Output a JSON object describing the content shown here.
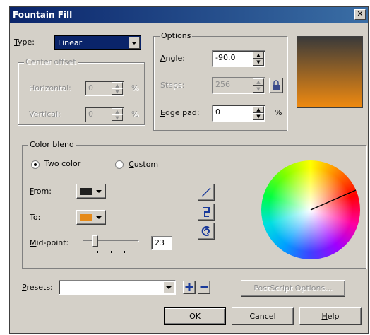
{
  "window": {
    "title": "Fountain Fill",
    "close_glyph": "✕"
  },
  "type": {
    "label": "Type:",
    "value": "Linear"
  },
  "center_offset": {
    "legend": "Center offset",
    "horizontal_label": "Horizontal:",
    "horizontal_value": "0",
    "vertical_label": "Vertical:",
    "vertical_value": "0",
    "unit": "%"
  },
  "options": {
    "legend": "Options",
    "angle_label": "Angle:",
    "angle_value": "-90.0",
    "steps_label": "Steps:",
    "steps_value": "256",
    "edge_pad_label": "Edge pad:",
    "edge_pad_value": "0",
    "edge_pad_unit": "%"
  },
  "preview": {
    "gradient_top": "#3a3a3a",
    "gradient_bottom": "#f08a10"
  },
  "color_blend": {
    "legend": "Color blend",
    "two_color_label": "Two color",
    "custom_label": "Custom",
    "selected": "two_color",
    "from_label": "From:",
    "from_color": "#202020",
    "to_label": "To:",
    "to_color": "#e58a1a",
    "midpoint_label": "Mid-point:",
    "midpoint_value": "23",
    "midpoint_fraction": 0.23
  },
  "presets": {
    "label": "Presets:",
    "value": ""
  },
  "buttons": {
    "postscript": "PostScript Options...",
    "ok": "OK",
    "cancel": "Cancel",
    "help": "Help"
  }
}
